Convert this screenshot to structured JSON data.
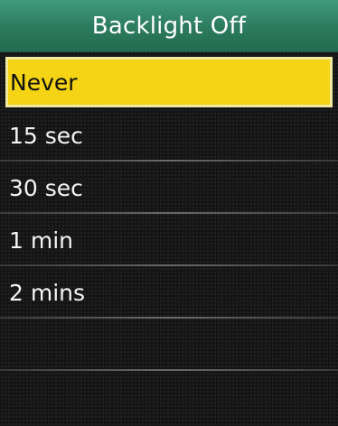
{
  "header": {
    "title": "Backlight Off"
  },
  "menu": {
    "selected_index": 0,
    "items": [
      {
        "label": "Never"
      },
      {
        "label": "15 sec"
      },
      {
        "label": "30 sec"
      },
      {
        "label": "1 min"
      },
      {
        "label": "2 mins"
      }
    ]
  },
  "colors": {
    "header_green": "#2c7a5e",
    "selection_yellow": "#f4d414",
    "background": "#141414"
  }
}
